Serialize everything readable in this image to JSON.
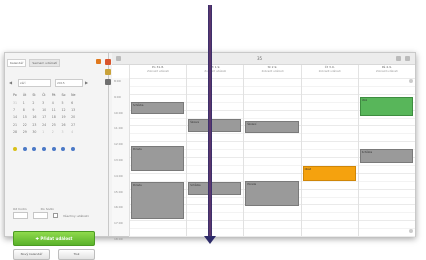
{
  "left_panel": {
    "tabs": [
      "Kalendář",
      "Seznam událostí"
    ],
    "month_select": "září",
    "year_select": "2015",
    "weekdays": [
      "Po",
      "Út",
      "St",
      "Čt",
      "Pá",
      "So",
      "Ne"
    ],
    "days": [
      "31",
      "1",
      "2",
      "3",
      "4",
      "5",
      "6",
      "7",
      "8",
      "9",
      "10",
      "11",
      "12",
      "13",
      "14",
      "15",
      "16",
      "17",
      "18",
      "19",
      "20",
      "21",
      "22",
      "23",
      "24",
      "25",
      "26",
      "27",
      "28",
      "29",
      "30",
      "1",
      "2",
      "3",
      "4"
    ],
    "field_labels": [
      "Od hodin",
      "Do hodin"
    ],
    "checkbox_label": "Všechny události",
    "new_event_button": "Přidat událost",
    "secondary_buttons": [
      "Nový kalendář",
      "Tisk"
    ]
  },
  "calendar": {
    "title": "35",
    "days": [
      {
        "name": "Po 31.8.",
        "sub": "Zobrazit události"
      },
      {
        "name": "Út 1.9.",
        "sub": "Zobrazit události"
      },
      {
        "name": "St 2.9.",
        "sub": "Zobrazit události"
      },
      {
        "name": "Čt 3.9.",
        "sub": "Zobrazit události"
      },
      {
        "name": "Pá 4.9.",
        "sub": "Zobrazit události"
      }
    ],
    "time_labels": [
      "8:00",
      "9:00",
      "10:00",
      "11:00",
      "12:00",
      "13:00",
      "14:00",
      "15:00",
      "16:00",
      "17:00",
      "18:00"
    ],
    "events": [
      {
        "day": 0,
        "start": 9.5,
        "end": 10.3,
        "color": "#9a9a9a",
        "label": "Schůzka"
      },
      {
        "day": 0,
        "start": 12.3,
        "end": 13.9,
        "color": "#9a9a9a",
        "label": "Porada"
      },
      {
        "day": 0,
        "start": 14.6,
        "end": 16.9,
        "color": "#9a9a9a",
        "label": "Porada"
      },
      {
        "day": 1,
        "start": 10.6,
        "end": 11.4,
        "color": "#9a9a9a",
        "label": "Školení"
      },
      {
        "day": 1,
        "start": 14.6,
        "end": 15.4,
        "color": "#9a9a9a",
        "label": "Schůzka"
      },
      {
        "day": 2,
        "start": 10.7,
        "end": 11.5,
        "color": "#9a9a9a",
        "label": "Školení"
      },
      {
        "day": 2,
        "start": 14.5,
        "end": 16.1,
        "color": "#9a9a9a",
        "label": "Porada"
      },
      {
        "day": 3,
        "start": 13.6,
        "end": 14.5,
        "color": "#f5a20e",
        "label": "Oběd"
      },
      {
        "day": 4,
        "start": 9.2,
        "end": 10.4,
        "color": "#58b65a",
        "label": "Úkol"
      },
      {
        "day": 4,
        "start": 12.5,
        "end": 13.4,
        "color": "#9a9a9a",
        "label": "Schůzka"
      }
    ]
  },
  "colors": {
    "accent_green": "#5ab22a",
    "event_grey": "#9a9a9a",
    "event_green": "#58b65a",
    "event_orange": "#f5a20e",
    "overlay_line": "#2e2c6a"
  }
}
